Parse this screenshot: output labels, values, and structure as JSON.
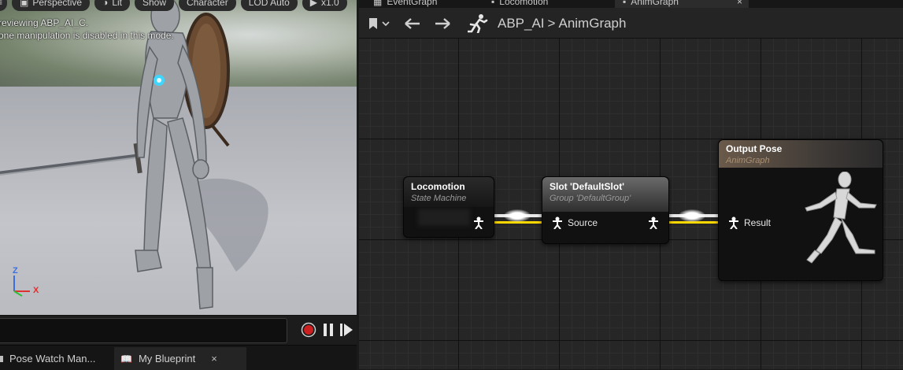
{
  "viewport": {
    "toolbar": {
      "menu_label": "≡",
      "perspective_label": "Perspective",
      "lit_label": "Lit",
      "show_label": "Show",
      "character_label": "Character",
      "lod_label": "LOD Auto",
      "speed_label": "x1.0"
    },
    "messages": {
      "line1": "Previewing ABP_AI_C.",
      "line2": "Bone manipulation is disabled in this mode."
    },
    "axes": {
      "z": "Z",
      "x": "X"
    }
  },
  "timeline": {
    "record": "record",
    "pause": "pause",
    "play": "play"
  },
  "bottom_tabs": [
    {
      "label": "Pose Watch Man..."
    },
    {
      "label": "My Blueprint",
      "close": "×"
    }
  ],
  "graph_tabs": [
    {
      "label": "EventGraph"
    },
    {
      "label": "Locomotion"
    },
    {
      "label": "AnimGraph",
      "close": "×"
    }
  ],
  "breadcrumb": {
    "root": "ABP_AI",
    "separator": ">",
    "current": "AnimGraph"
  },
  "nodes": {
    "locomotion": {
      "title": "Locomotion",
      "subtitle": "State Machine"
    },
    "slot": {
      "title": "Slot 'DefaultSlot'",
      "subtitle": "Group 'DefaultGroup'",
      "pin": "Source"
    },
    "output": {
      "title": "Output Pose",
      "subtitle": "AnimGraph",
      "pin": "Result"
    }
  },
  "colors": {
    "accent": "#ffd800",
    "wire": "#ffffff",
    "record": "#cc1f1f",
    "axis_x": "#e03030",
    "axis_y": "#2fbf3a",
    "axis_z": "#3b6fe0"
  }
}
